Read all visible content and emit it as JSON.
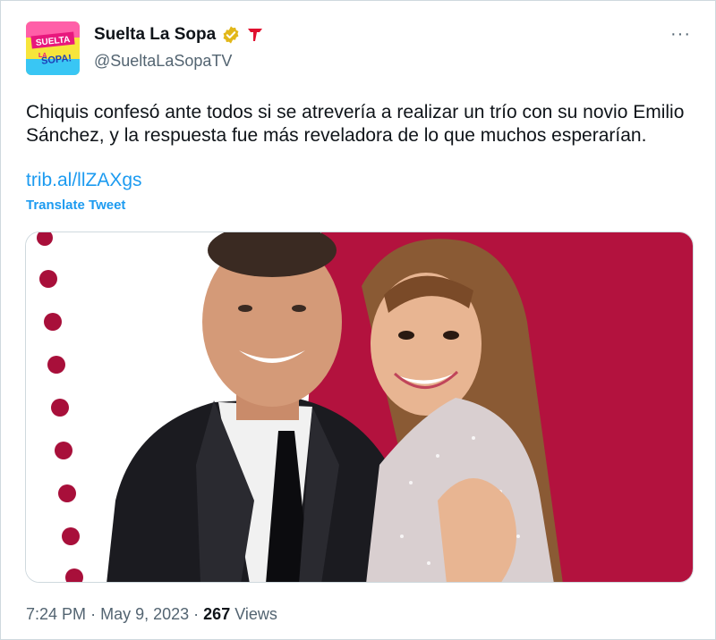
{
  "account": {
    "display_name": "Suelta La Sopa",
    "handle": "@SueltaLaSopaTV",
    "avatar_text_top": "SUELTA",
    "avatar_text_bottom": "SOPA!",
    "avatar_text_la": "LA",
    "verified_color": "#e2b719",
    "affiliate_icon": "telemundo-t-icon",
    "affiliate_color": "#e0102f"
  },
  "tweet": {
    "text": "Chiquis confesó ante todos si se atrevería a realizar un trío con su novio Emilio Sánchez, y la respuesta fue más reveladora de lo que muchos esperarían.",
    "link": "trib.al/llZAXgs",
    "translate_label": "Translate Tweet"
  },
  "media": {
    "background_color": "#b3123e",
    "dots_color": "#a80f3a"
  },
  "footer": {
    "time": "7:24 PM",
    "separator": "·",
    "date": "May 9, 2023",
    "views_count": "267",
    "views_label": "Views"
  },
  "colors": {
    "text": "#0f1419",
    "secondary": "#536471",
    "link": "#1d9bf0"
  }
}
